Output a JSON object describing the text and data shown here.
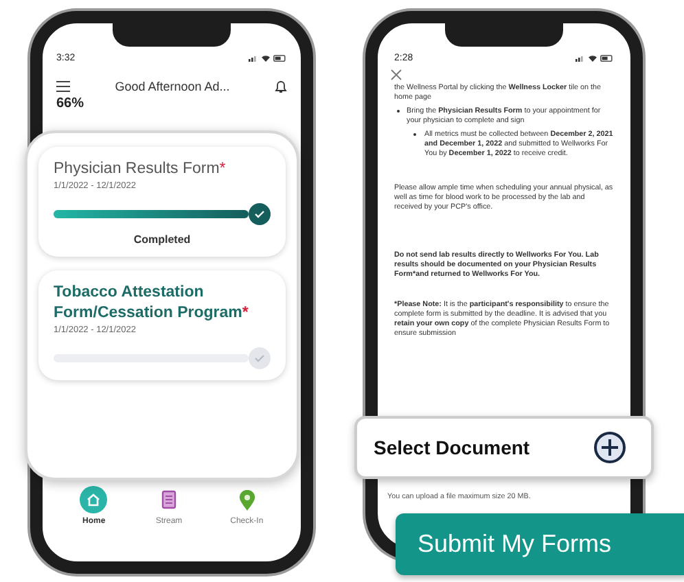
{
  "home_screen": {
    "status_bar": {
      "time": "3:32"
    },
    "header": {
      "greeting": "Good Afternoon Ad..."
    },
    "progress": "66%",
    "forms": [
      {
        "title": "Physician Results Form",
        "required_mark": "*",
        "dates": "1/1/2022 - 12/1/2022",
        "completed": true,
        "level": 1,
        "status": "Completed"
      },
      {
        "title": "Tobacco Attestation Form/Cessation Program",
        "required_mark": "*",
        "dates": "1/1/2022 - 12/1/2022",
        "completed": false
      }
    ],
    "nav": [
      {
        "label": "Home",
        "kind": "home",
        "selected": true,
        "color": "#2bb5a8"
      },
      {
        "label": "Stream",
        "kind": "stream",
        "selected": false,
        "color": "#a24ea6"
      },
      {
        "label": "Check-In",
        "kind": "checkin",
        "selected": false,
        "color": "#5aa832"
      }
    ]
  },
  "document_screen": {
    "status_bar": {
      "time": "2:28"
    },
    "paragraphs": [
      {
        "kind": "text",
        "text": "the Wellness Portal by clicking the **Wellness Locker** tile on the home page"
      },
      {
        "kind": "bullet",
        "text": "Bring the **Physician Results Form** to your appointment for your physician to complete and sign"
      },
      {
        "kind": "subbullet",
        "text": "All metrics must be collected between **December 2, 2021 and December 1, 2022** and submitted to Wellworks For You by **December 1, 2022** to receive credit."
      },
      {
        "kind": "text",
        "text": "Please allow ample time when scheduling your annual physical, as well as time for blood work to be processed by the lab and received by your PCP's office."
      },
      {
        "kind": "bold",
        "text": "Do not send lab results directly to Wellworks For You. Lab results should be documented on your Physician Results Form*and returned to Wellworks For You."
      },
      {
        "kind": "note",
        "lead": "*Please Note:",
        "text": "It is the **participant's responsibility** to ensure the complete form is submitted by the deadline. It is advised that you **retain your own copy** of the complete Physician Results Form to ensure submission"
      }
    ],
    "select_document": {
      "label": "Select Document"
    },
    "upload_note": "You can upload a file maximum size 20 MB.",
    "submit_button": {
      "label": "Submit My Forms"
    }
  }
}
